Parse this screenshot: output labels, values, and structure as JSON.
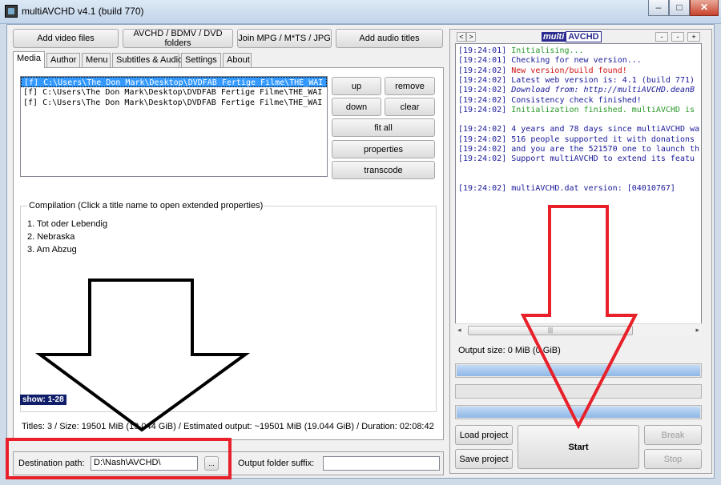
{
  "window": {
    "title": "multiAVCHD v4.1 (build 770)",
    "controls": {
      "minimize": "–",
      "maximize": "□",
      "close": "✕"
    }
  },
  "toolbar": {
    "add_video": "Add video files",
    "avchd_folders": "AVCHD / BDMV / DVD folders",
    "join_mpg": "Join MPG / M*TS / JPG",
    "add_audio": "Add audio titles"
  },
  "tabs": [
    "Media",
    "Author",
    "Menu",
    "Subtitles & Audio",
    "Settings",
    "About"
  ],
  "media": {
    "files": [
      "[f] C:\\Users\\The Don Mark\\Desktop\\DVDFAB Fertige Filme\\THE_WAI",
      "[f] C:\\Users\\The Don Mark\\Desktop\\DVDFAB Fertige Filme\\THE_WAI",
      "[f] C:\\Users\\The Don Mark\\Desktop\\DVDFAB Fertige Filme\\THE_WAI"
    ],
    "buttons": {
      "up": "up",
      "remove": "remove",
      "down": "down",
      "clear": "clear",
      "fit_all": "fit all",
      "properties": "properties",
      "transcode": "transcode"
    },
    "compilation_label": "Compilation (Click a title name to open extended properties)",
    "titles": [
      "1. Tot oder Lebendig",
      "2. Nebraska",
      "3. Am Abzug"
    ],
    "show_badge": "show: 1-28",
    "stats": "Titles: 3 / Size: 19501 MiB (19.044 GiB) / Estimated output: ~19501 MiB (19.044 GiB) / Duration: 02:08:42"
  },
  "destination": {
    "label": "Destination path:",
    "value": "D:\\Nash\\AVCHD\\",
    "browse": "...",
    "suffix_label": "Output folder suffix:",
    "suffix_value": ""
  },
  "log_panel": {
    "nav": [
      "<",
      ">"
    ],
    "logo_multi": "multi",
    "logo_avchd": "AVCHD",
    "zoom": [
      "-",
      "+"
    ],
    "lines": [
      {
        "t": "[19:24:01]",
        "msg": "Initialising...",
        "color": "#2a9a2a"
      },
      {
        "t": "[19:24:01]",
        "msg": "Checking for new version...",
        "color": "#1a1a9a"
      },
      {
        "t": "[19:24:02]",
        "msg": "New version/build found!",
        "color": "#d01010"
      },
      {
        "t": "[19:24:02]",
        "msg": "Latest web version is: 4.1 (build 771)",
        "color": "#1a1a9a"
      },
      {
        "t": "[19:24:02]",
        "msg": "Download from: http://multiAVCHD.deanB",
        "color": "#1a1a9a",
        "italic": true
      },
      {
        "t": "[19:24:02]",
        "msg": "Consistency check finished!",
        "color": "#1a1a9a"
      },
      {
        "t": "[19:24:02]",
        "msg": "Initialization finished. multiAVCHD is",
        "color": "#2a9a2a"
      },
      {
        "t": "",
        "msg": "",
        "color": "#1a1a9a"
      },
      {
        "t": "[19:24:02]",
        "msg": "4 years and 78 days since multiAVCHD wa",
        "color": "#1a1a9a"
      },
      {
        "t": "[19:24:02]",
        "msg": "516 people supported it with donations",
        "color": "#1a1a9a"
      },
      {
        "t": "[19:24:02]",
        "msg": "and you are the 521570 one to launch th",
        "color": "#1a1a9a"
      },
      {
        "t": "[19:24:02]",
        "msg": "Support multiAVCHD to extend its featu",
        "color": "#1a1a9a"
      },
      {
        "t": "",
        "msg": "",
        "color": "#1a1a9a"
      },
      {
        "t": "",
        "msg": "",
        "color": "#1a1a9a"
      },
      {
        "t": "[19:24:02]",
        "msg": "multiAVCHD.dat version: [04010767]",
        "color": "#1a1a9a"
      }
    ],
    "output_size": "Output size: 0 MiB (0 GiB)",
    "progress_levels": [
      1.0,
      0.0,
      1.0
    ]
  },
  "actions": {
    "load_project": "Load project",
    "save_project": "Save project",
    "start": "Start",
    "break": "Break",
    "stop": "Stop"
  },
  "colors": {
    "accent_red": "#e8202a",
    "selection_blue": "#3399ff",
    "badge_navy": "#101e6a"
  }
}
